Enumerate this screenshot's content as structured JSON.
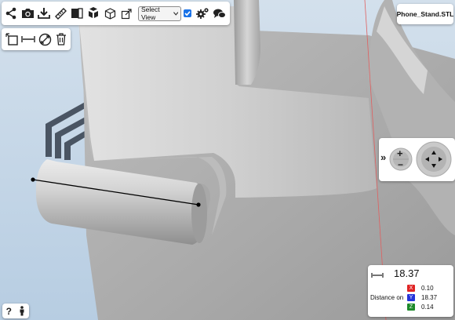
{
  "toolbar": {
    "icons": [
      "share-icon",
      "camera-icon",
      "download-icon",
      "ruler-icon",
      "section-icon",
      "explode-icon",
      "box-icon",
      "popout-icon"
    ],
    "select_view_label": "Select View",
    "view_checkbox_checked": true,
    "settings_icon": "gears-icon",
    "comment_icon": "chat-icon"
  },
  "tools2": {
    "icons": [
      "bounding-box-icon",
      "measure-distance-icon",
      "diameter-icon",
      "trash-icon"
    ]
  },
  "file": {
    "name": "Phone_Stand.STL"
  },
  "navigation": {
    "expand_glyph": "»",
    "zoom_in": "+",
    "zoom_out": "−"
  },
  "measurement": {
    "value": "18.37",
    "label": "Distance on",
    "axes": [
      {
        "axis": "X",
        "value": "0.10",
        "color": "#e02424"
      },
      {
        "axis": "Y",
        "value": "18.37",
        "color": "#2533d9"
      },
      {
        "axis": "Z",
        "value": "0.14",
        "color": "#1d8a2a"
      }
    ]
  },
  "help": {
    "help_label": "?",
    "person_icon": "person-icon"
  },
  "colors": {
    "background": "#c7d9ea",
    "model": "#c4c4c4",
    "measure_line": "#000000",
    "axis_line": "#e06060"
  }
}
